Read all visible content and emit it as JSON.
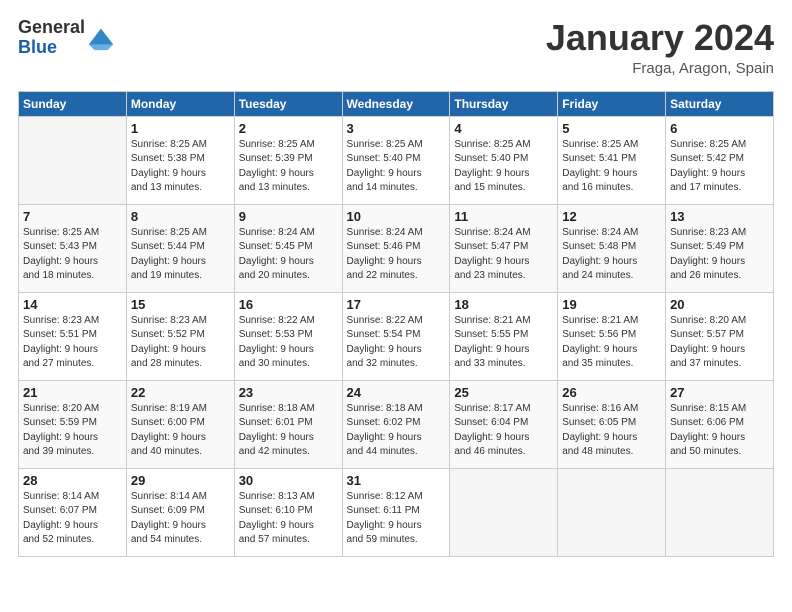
{
  "header": {
    "logo_general": "General",
    "logo_blue": "Blue",
    "month": "January 2024",
    "location": "Fraga, Aragon, Spain"
  },
  "days_of_week": [
    "Sunday",
    "Monday",
    "Tuesday",
    "Wednesday",
    "Thursday",
    "Friday",
    "Saturday"
  ],
  "weeks": [
    [
      {
        "day": "",
        "sunrise": "",
        "sunset": "",
        "daylight": ""
      },
      {
        "day": "1",
        "sunrise": "Sunrise: 8:25 AM",
        "sunset": "Sunset: 5:38 PM",
        "daylight": "Daylight: 9 hours and 13 minutes."
      },
      {
        "day": "2",
        "sunrise": "Sunrise: 8:25 AM",
        "sunset": "Sunset: 5:39 PM",
        "daylight": "Daylight: 9 hours and 13 minutes."
      },
      {
        "day": "3",
        "sunrise": "Sunrise: 8:25 AM",
        "sunset": "Sunset: 5:40 PM",
        "daylight": "Daylight: 9 hours and 14 minutes."
      },
      {
        "day": "4",
        "sunrise": "Sunrise: 8:25 AM",
        "sunset": "Sunset: 5:40 PM",
        "daylight": "Daylight: 9 hours and 15 minutes."
      },
      {
        "day": "5",
        "sunrise": "Sunrise: 8:25 AM",
        "sunset": "Sunset: 5:41 PM",
        "daylight": "Daylight: 9 hours and 16 minutes."
      },
      {
        "day": "6",
        "sunrise": "Sunrise: 8:25 AM",
        "sunset": "Sunset: 5:42 PM",
        "daylight": "Daylight: 9 hours and 17 minutes."
      }
    ],
    [
      {
        "day": "7",
        "sunrise": "Sunrise: 8:25 AM",
        "sunset": "Sunset: 5:43 PM",
        "daylight": "Daylight: 9 hours and 18 minutes."
      },
      {
        "day": "8",
        "sunrise": "Sunrise: 8:25 AM",
        "sunset": "Sunset: 5:44 PM",
        "daylight": "Daylight: 9 hours and 19 minutes."
      },
      {
        "day": "9",
        "sunrise": "Sunrise: 8:24 AM",
        "sunset": "Sunset: 5:45 PM",
        "daylight": "Daylight: 9 hours and 20 minutes."
      },
      {
        "day": "10",
        "sunrise": "Sunrise: 8:24 AM",
        "sunset": "Sunset: 5:46 PM",
        "daylight": "Daylight: 9 hours and 22 minutes."
      },
      {
        "day": "11",
        "sunrise": "Sunrise: 8:24 AM",
        "sunset": "Sunset: 5:47 PM",
        "daylight": "Daylight: 9 hours and 23 minutes."
      },
      {
        "day": "12",
        "sunrise": "Sunrise: 8:24 AM",
        "sunset": "Sunset: 5:48 PM",
        "daylight": "Daylight: 9 hours and 24 minutes."
      },
      {
        "day": "13",
        "sunrise": "Sunrise: 8:23 AM",
        "sunset": "Sunset: 5:49 PM",
        "daylight": "Daylight: 9 hours and 26 minutes."
      }
    ],
    [
      {
        "day": "14",
        "sunrise": "Sunrise: 8:23 AM",
        "sunset": "Sunset: 5:51 PM",
        "daylight": "Daylight: 9 hours and 27 minutes."
      },
      {
        "day": "15",
        "sunrise": "Sunrise: 8:23 AM",
        "sunset": "Sunset: 5:52 PM",
        "daylight": "Daylight: 9 hours and 28 minutes."
      },
      {
        "day": "16",
        "sunrise": "Sunrise: 8:22 AM",
        "sunset": "Sunset: 5:53 PM",
        "daylight": "Daylight: 9 hours and 30 minutes."
      },
      {
        "day": "17",
        "sunrise": "Sunrise: 8:22 AM",
        "sunset": "Sunset: 5:54 PM",
        "daylight": "Daylight: 9 hours and 32 minutes."
      },
      {
        "day": "18",
        "sunrise": "Sunrise: 8:21 AM",
        "sunset": "Sunset: 5:55 PM",
        "daylight": "Daylight: 9 hours and 33 minutes."
      },
      {
        "day": "19",
        "sunrise": "Sunrise: 8:21 AM",
        "sunset": "Sunset: 5:56 PM",
        "daylight": "Daylight: 9 hours and 35 minutes."
      },
      {
        "day": "20",
        "sunrise": "Sunrise: 8:20 AM",
        "sunset": "Sunset: 5:57 PM",
        "daylight": "Daylight: 9 hours and 37 minutes."
      }
    ],
    [
      {
        "day": "21",
        "sunrise": "Sunrise: 8:20 AM",
        "sunset": "Sunset: 5:59 PM",
        "daylight": "Daylight: 9 hours and 39 minutes."
      },
      {
        "day": "22",
        "sunrise": "Sunrise: 8:19 AM",
        "sunset": "Sunset: 6:00 PM",
        "daylight": "Daylight: 9 hours and 40 minutes."
      },
      {
        "day": "23",
        "sunrise": "Sunrise: 8:18 AM",
        "sunset": "Sunset: 6:01 PM",
        "daylight": "Daylight: 9 hours and 42 minutes."
      },
      {
        "day": "24",
        "sunrise": "Sunrise: 8:18 AM",
        "sunset": "Sunset: 6:02 PM",
        "daylight": "Daylight: 9 hours and 44 minutes."
      },
      {
        "day": "25",
        "sunrise": "Sunrise: 8:17 AM",
        "sunset": "Sunset: 6:04 PM",
        "daylight": "Daylight: 9 hours and 46 minutes."
      },
      {
        "day": "26",
        "sunrise": "Sunrise: 8:16 AM",
        "sunset": "Sunset: 6:05 PM",
        "daylight": "Daylight: 9 hours and 48 minutes."
      },
      {
        "day": "27",
        "sunrise": "Sunrise: 8:15 AM",
        "sunset": "Sunset: 6:06 PM",
        "daylight": "Daylight: 9 hours and 50 minutes."
      }
    ],
    [
      {
        "day": "28",
        "sunrise": "Sunrise: 8:14 AM",
        "sunset": "Sunset: 6:07 PM",
        "daylight": "Daylight: 9 hours and 52 minutes."
      },
      {
        "day": "29",
        "sunrise": "Sunrise: 8:14 AM",
        "sunset": "Sunset: 6:09 PM",
        "daylight": "Daylight: 9 hours and 54 minutes."
      },
      {
        "day": "30",
        "sunrise": "Sunrise: 8:13 AM",
        "sunset": "Sunset: 6:10 PM",
        "daylight": "Daylight: 9 hours and 57 minutes."
      },
      {
        "day": "31",
        "sunrise": "Sunrise: 8:12 AM",
        "sunset": "Sunset: 6:11 PM",
        "daylight": "Daylight: 9 hours and 59 minutes."
      },
      {
        "day": "",
        "sunrise": "",
        "sunset": "",
        "daylight": ""
      },
      {
        "day": "",
        "sunrise": "",
        "sunset": "",
        "daylight": ""
      },
      {
        "day": "",
        "sunrise": "",
        "sunset": "",
        "daylight": ""
      }
    ]
  ]
}
